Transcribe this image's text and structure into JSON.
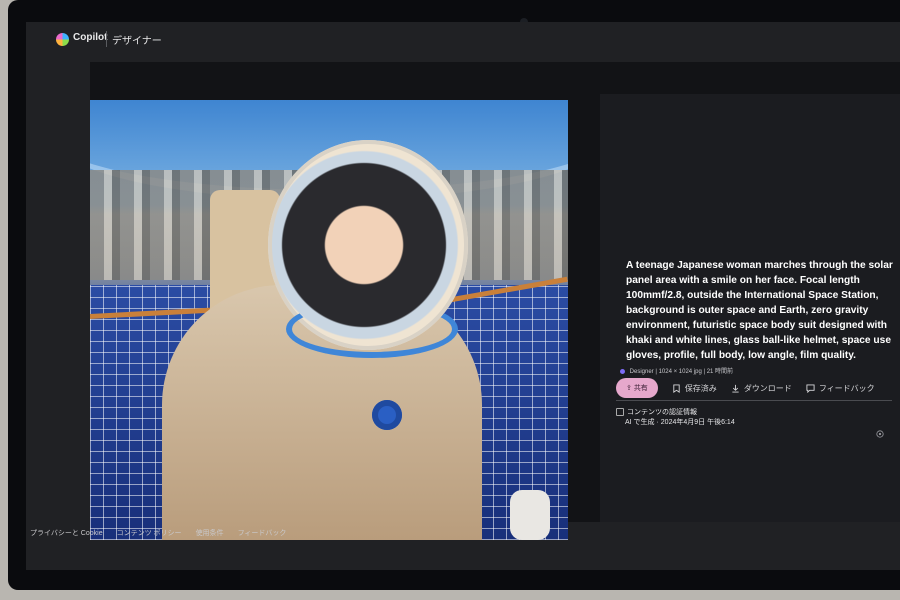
{
  "header": {
    "brand": "Copilot",
    "product": "デザイナー"
  },
  "image": {
    "icon": "generated-image"
  },
  "details": {
    "prompt": "A teenage Japanese woman marches through the solar panel area with a smile on her face. Focal length 100mmf/2.8, outside the International Space Station, background is outer space and Earth, zero gravity environment, futuristic space body suit designed with khaki and white lines, glass ball-like helmet, space use gloves, profile, full body, low angle, film quality.",
    "meta": {
      "source": "Designer",
      "size": "1024 × 1024 jpg",
      "time": "21 時間前"
    },
    "actions": {
      "share": "共有",
      "saved": "保存済み",
      "download": "ダウンロード",
      "feedback": "フィードバック"
    },
    "credentials_label": "コンテンツの認証情報",
    "created_line": "AI で生成 · 2024年4月9日 午後6:14"
  },
  "footer": {
    "links": [
      "プライバシーと Cookie",
      "コンテンツ ポリシー",
      "使用条件",
      "フィードバック"
    ]
  },
  "colors": {
    "share_button": "#e6a8cc",
    "background": "#202124"
  }
}
